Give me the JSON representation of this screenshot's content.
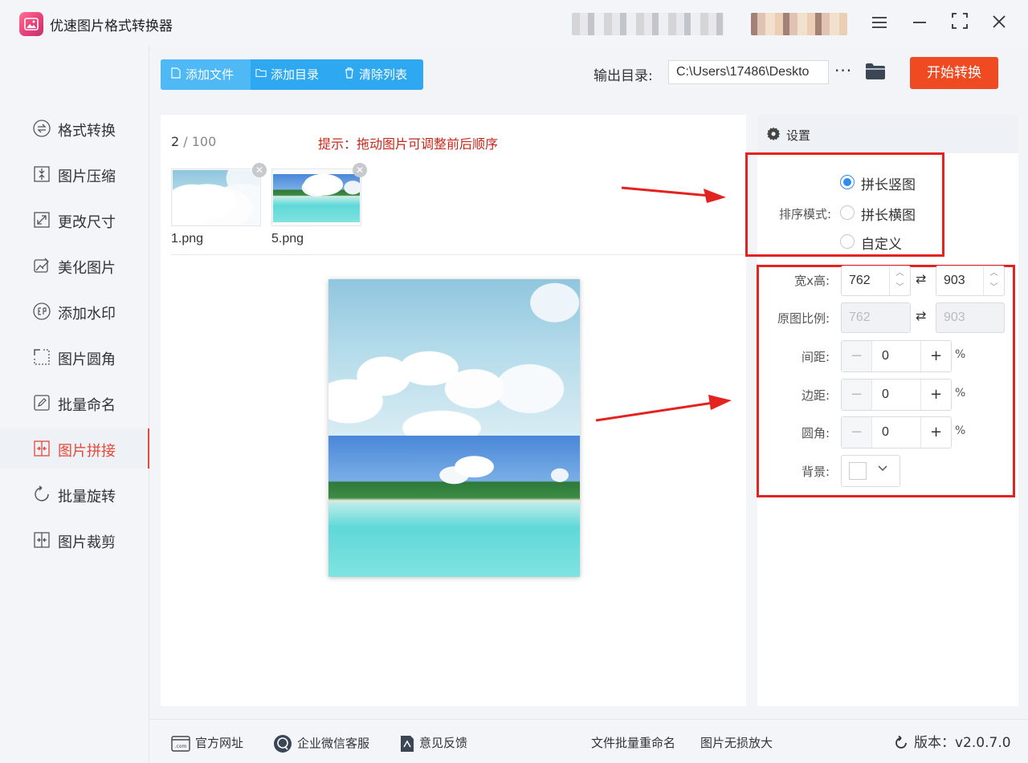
{
  "app": {
    "title": "优速图片格式转换器"
  },
  "sidebar": {
    "items": [
      {
        "label": "格式转换",
        "icon": "format-convert-icon"
      },
      {
        "label": "图片压缩",
        "icon": "compress-icon"
      },
      {
        "label": "更改尺寸",
        "icon": "resize-icon"
      },
      {
        "label": "美化图片",
        "icon": "beautify-icon"
      },
      {
        "label": "添加水印",
        "icon": "watermark-icon"
      },
      {
        "label": "图片圆角",
        "icon": "rounded-corner-icon"
      },
      {
        "label": "批量命名",
        "icon": "rename-icon"
      },
      {
        "label": "图片拼接",
        "icon": "stitch-icon",
        "active": true
      },
      {
        "label": "批量旋转",
        "icon": "rotate-icon"
      },
      {
        "label": "图片裁剪",
        "icon": "crop-icon"
      }
    ]
  },
  "toolbar": {
    "add_file": "添加文件",
    "add_dir": "添加目录",
    "clear_list": "清除列表",
    "output_label": "输出目录:",
    "output_path": "C:\\Users\\17486\\Deskto",
    "more": "···",
    "start": "开始转换"
  },
  "list": {
    "count": "2",
    "total": " / 100",
    "hint": "提示：拖动图片可调整前后顺序",
    "files": [
      {
        "name": "1.png"
      },
      {
        "name": "5.png"
      }
    ]
  },
  "settings": {
    "title": "设置",
    "sort_label": "排序模式:",
    "sort_options": [
      "拼长竖图",
      "拼长横图",
      "自定义"
    ],
    "sort_selected": "拼长竖图",
    "wh_label": "宽x高:",
    "width": "762",
    "height": "903",
    "ratio_label": "原图比例:",
    "ratio_width": "762",
    "ratio_height": "903",
    "gap_label": "间距:",
    "gap_value": "0",
    "margin_label": "边距:",
    "margin_value": "0",
    "radius_label": "圆角:",
    "radius_value": "0",
    "unit": "%",
    "bg_label": "背景:",
    "bg_color": "#ffffff"
  },
  "footer": {
    "site": "官方网址",
    "wechat": "企业微信客服",
    "feedback": "意见反馈",
    "batch_rename": "文件批量重命名",
    "lossless_enlarge": "图片无损放大",
    "version": "版本：v2.0.7.0"
  },
  "colors": {
    "accent_blue": "#2ea8f0",
    "start_button": "#ef4a21",
    "active_red": "#e5483b",
    "hint_red": "#c8261a",
    "annotation_red": "#e3231f"
  }
}
